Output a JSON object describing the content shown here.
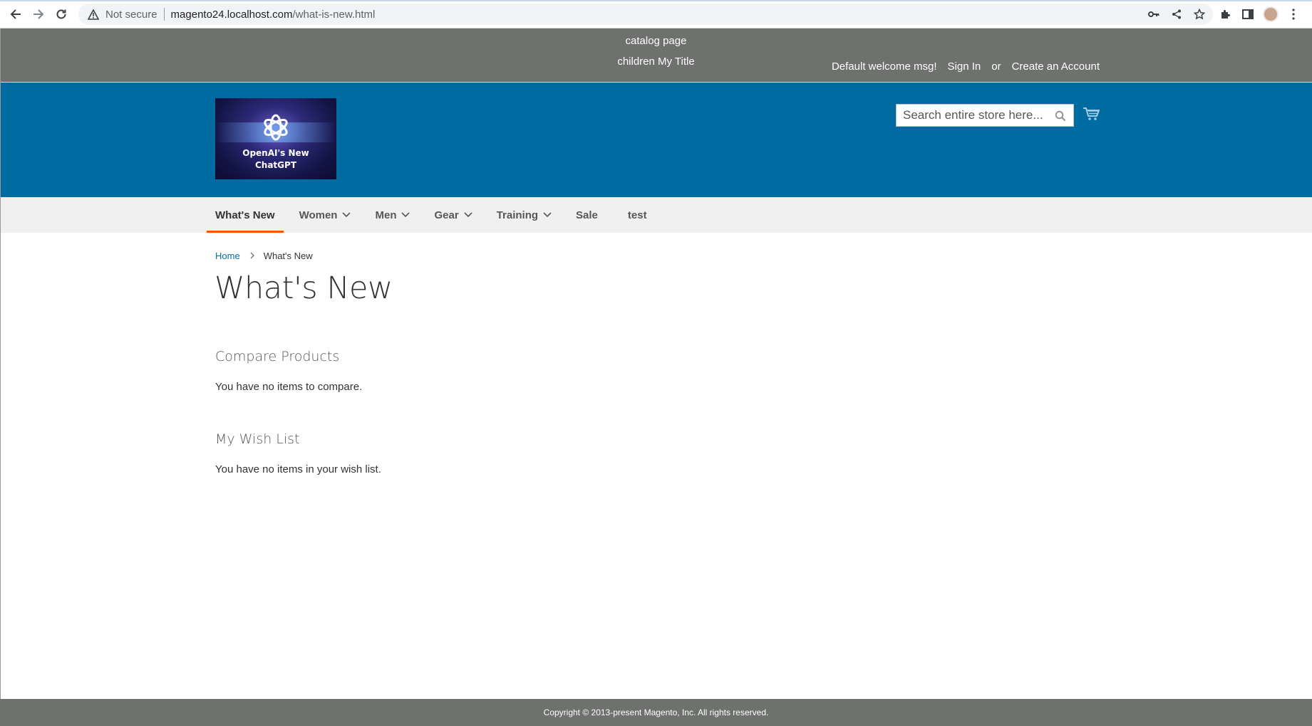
{
  "browser": {
    "security_label": "Not secure",
    "url_host": "magento24.localhost.com",
    "url_path": "/what-is-new.html"
  },
  "panel": {
    "custom_line_1": "catalog page",
    "custom_line_2": "children My Title",
    "welcome": "Default welcome msg!",
    "sign_in": "Sign In",
    "or": "or",
    "create_account": "Create an Account"
  },
  "logo": {
    "line_1": "OpenAI's New",
    "line_2": "ChatGPT"
  },
  "search": {
    "placeholder": "Search entire store here..."
  },
  "nav": {
    "items": [
      {
        "label": "What's New"
      },
      {
        "label": "Women"
      },
      {
        "label": "Men"
      },
      {
        "label": "Gear"
      },
      {
        "label": "Training"
      },
      {
        "label": "Sale"
      },
      {
        "label": "test"
      }
    ]
  },
  "breadcrumbs": {
    "home": "Home",
    "current": "What's New"
  },
  "page": {
    "title": "What's New"
  },
  "compare": {
    "title": "Compare Products",
    "empty": "You have no items to compare."
  },
  "wishlist": {
    "title": "My Wish List",
    "empty": "You have no items in your wish list."
  },
  "footer": {
    "copyright": "Copyright © 2013-present Magento, Inc. All rights reserved."
  },
  "colors": {
    "header_blue": "#006ba1",
    "panel_gray": "#6e716e",
    "nav_bg": "#f0f0f0",
    "active_underline": "#ff5501",
    "link_blue": "#006bb4"
  }
}
